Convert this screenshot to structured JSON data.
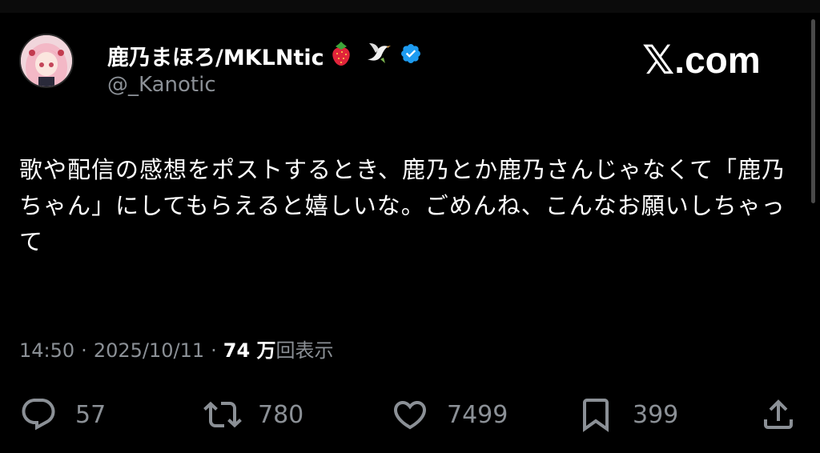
{
  "author": {
    "display_name": "鹿乃まほろ/MKLNtic",
    "handle": "@_Kanotic",
    "emojis": [
      "strawberry-icon",
      "dove-icon"
    ],
    "verified": true
  },
  "brand": {
    "x_glyph": "𝕏",
    "text": ".com"
  },
  "post": {
    "text": "歌や配信の感想をポストするとき、鹿乃とか鹿乃さんじゃなくて「鹿乃ちゃん」にしてもらえると嬉しいな。ごめんね、こんなお願いしちゃって"
  },
  "meta": {
    "time": "14:50",
    "date": "2025/10/11",
    "separator": "·",
    "views_count": "74 万",
    "views_label": "回表示"
  },
  "actions": {
    "replies": "57",
    "reposts": "780",
    "likes": "7499",
    "bookmarks": "399"
  },
  "colors": {
    "background": "#000000",
    "text": "#ffffff",
    "muted": "#8b9096",
    "verified": "#1d9bf0"
  }
}
